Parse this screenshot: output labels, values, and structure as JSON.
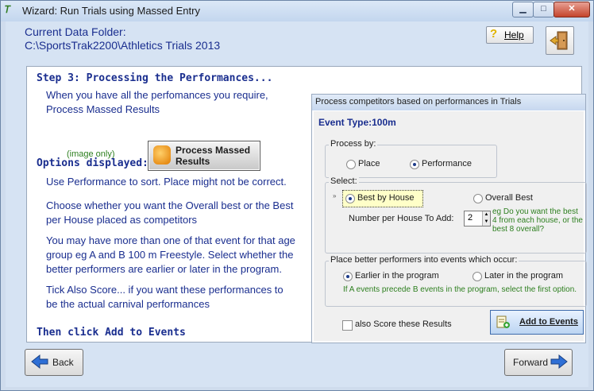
{
  "window": {
    "title": "Wizard:  Run Trials using Massed Entry",
    "app_icon_text": "𝑇",
    "controls": {
      "minimize": "▁",
      "maximize": "□",
      "close": "✕"
    }
  },
  "header": {
    "folder_label": "Current Data Folder:",
    "folder_path": "C:\\SportsTrak2200\\Athletics Trials 2013",
    "help_label": "Help",
    "help_glyph": "?"
  },
  "step": {
    "title": "Step 3: Processing the Performances...",
    "instruction_line1": "When you have all the perfomances you require,",
    "instruction_line2": "Process Massed Results",
    "image_only": "(image only)",
    "process_button_line1": "Process Massed",
    "process_button_line2": "Results"
  },
  "options": {
    "title": "Options displayed:",
    "p1": "Use Performance to sort.  Place might not be correct.",
    "p2_line1": "Choose whether you want the Overall best or the Best",
    "p2_line2": "per House placed as competitors",
    "p3_line1": "You may have more than one of that event for that age",
    "p3_line2": "group eg A and B 100 m Freestyle.  Select whether the",
    "p3_line3": "better performers are earlier or later in the program.",
    "p4_line1": "Tick Also Score... if you want these performances to",
    "p4_line2": "be the actual carnival performances",
    "then_click": "Then click Add to Events"
  },
  "dialog": {
    "title": "Process competitors based on performances in Trials",
    "event_type_label": "Event Type:",
    "event_type_value": "100m",
    "process_by": {
      "label": "Process by:",
      "place": "Place",
      "performance": "Performance",
      "selected": "performance"
    },
    "select": {
      "label": "Select:",
      "best_by_house": "Best by House",
      "overall_best": "Overall Best",
      "selected": "best_by_house",
      "number_label": "Number per House To Add:",
      "number_value": "2",
      "hint": "eg Do you want the best 4 from each house, or the best 8 overall?"
    },
    "place_better": {
      "label": "Place better performers into events which occur:",
      "earlier": "Earlier in the program",
      "later": "Later in the program",
      "selected": "earlier",
      "hint": "If A events precede B events in the program, select the first option."
    },
    "also_score_label": "also Score these Results",
    "also_score_checked": false,
    "add_to_events_label": "Add to Events"
  },
  "footer": {
    "back_label": "Back",
    "forward_label": "Forward"
  },
  "colors": {
    "instruction_text": "#1a2e8f",
    "hint_text": "#2d7f1f",
    "highlight": "#ffffc8"
  }
}
